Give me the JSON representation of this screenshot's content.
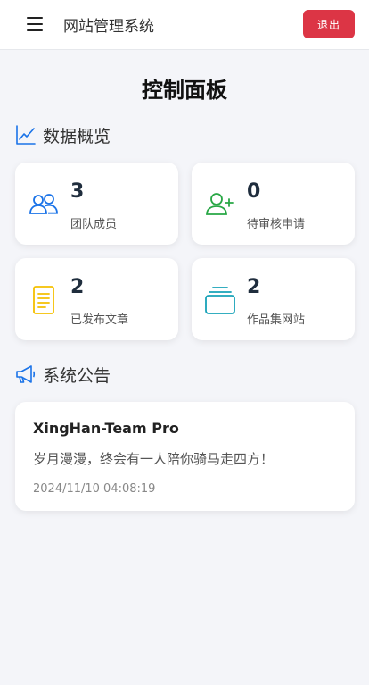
{
  "header": {
    "app_title": "网站管理系统",
    "logout_label": "退出"
  },
  "page": {
    "title": "控制面板"
  },
  "overview": {
    "section_title": "数据概览",
    "stats": [
      {
        "value": "3",
        "label": "团队成员",
        "icon": "team-icon",
        "color": "#1a73e8"
      },
      {
        "value": "0",
        "label": "待审核申请",
        "icon": "user-plus-icon",
        "color": "#28a745"
      },
      {
        "value": "2",
        "label": "已发布文章",
        "icon": "document-icon",
        "color": "#f5c000"
      },
      {
        "value": "2",
        "label": "作品集网站",
        "icon": "collection-icon",
        "color": "#17a2b8"
      }
    ]
  },
  "announcements": {
    "section_title": "系统公告",
    "items": [
      {
        "title": "XingHan-Team Pro",
        "content": "岁月漫漫，终会有一人陪你骑马走四方！",
        "time": "2024/11/10 04:08:19"
      }
    ]
  },
  "colors": {
    "accent": "#1a73e8",
    "danger": "#dc3545",
    "background": "#f4f5f9"
  }
}
